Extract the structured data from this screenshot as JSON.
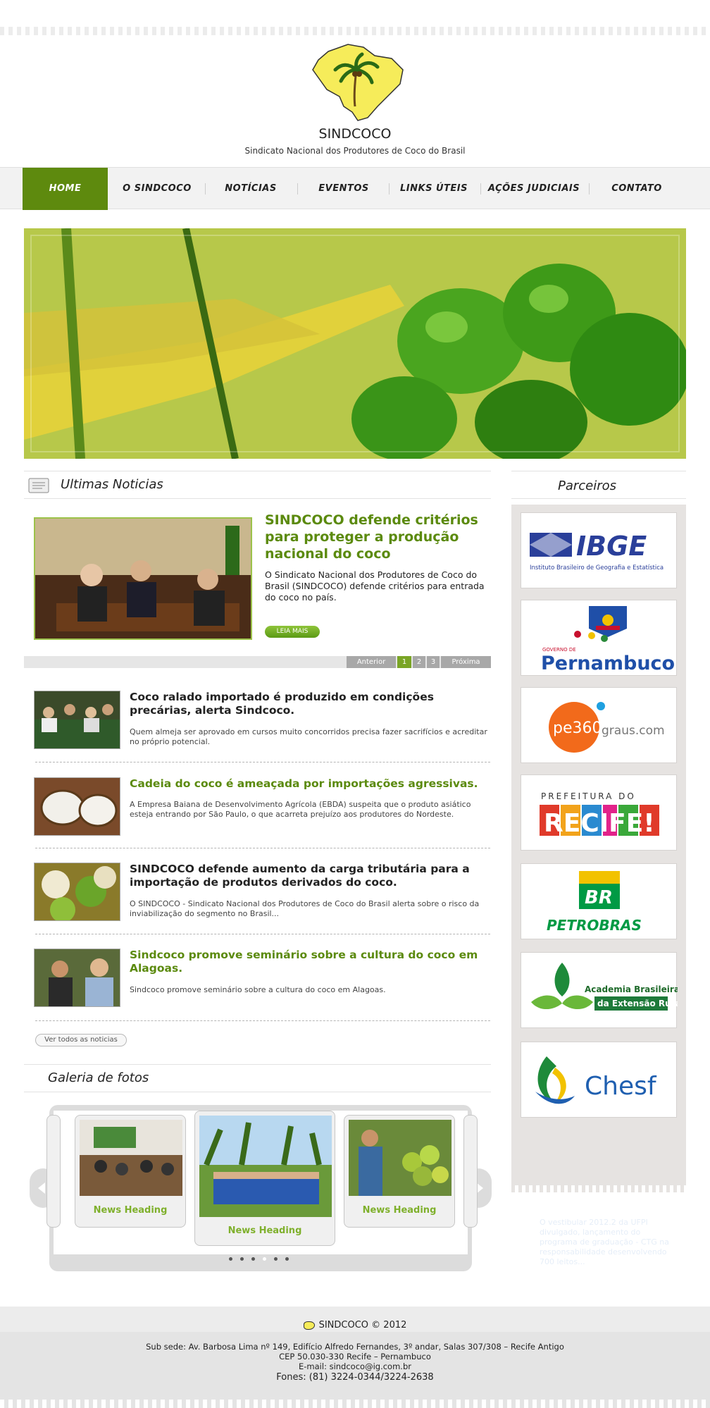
{
  "header": {
    "brand": "SINDCOCO",
    "tagline": "Sindicato Nacional dos Produtores de Coco do Brasil"
  },
  "nav": {
    "items": [
      "HOME",
      "O SINDCOCO",
      "NOTÍCIAS",
      "EVENTOS",
      "LINKS ÚTEIS",
      "AÇÕES JUDICIAIS",
      "CONTATO"
    ],
    "active": "HOME"
  },
  "colors": {
    "accent": "#5e8a0e",
    "link_green": "#5b8a0e",
    "caption_green": "#7fb02c"
  },
  "news_section": {
    "title": "Ultimas Noticias",
    "featured": {
      "title": "SINDCOCO defende critérios para proteger a produção nacional do coco",
      "text": "O Sindicato Nacional dos Produtores de Coco do Brasil (SINDCOCO) defende critérios para entrada do coco no país.",
      "button": "LEIA MAIS"
    },
    "pager": {
      "prev": "Anterior",
      "pages": [
        "1",
        "2",
        "3"
      ],
      "current": "1",
      "next": "Próxima"
    },
    "items": [
      {
        "title": "Coco ralado importado é produzido em condições precárias, alerta Sindcoco.",
        "text": "Quem almeja ser aprovado em cursos muito concorridos precisa fazer sacrifícios e acreditar no próprio potencial."
      },
      {
        "title": "Cadeia do coco é ameaçada por importações agressivas.",
        "text": "A Empresa Baiana de Desenvolvimento Agrícola (EBDA) suspeita que o produto asiático esteja entrando por São Paulo, o que acarreta prejuízo aos produtores do Nordeste."
      },
      {
        "title": "SINDCOCO defende aumento da carga tributária para a importação de produtos derivados do coco.",
        "text": "O SINDCOCO - Sindicato Nacional dos Produtores de Coco do Brasil alerta sobre o risco da inviabilização do segmento no Brasil..."
      },
      {
        "title": "Sindcoco promove seminário sobre a cultura do coco em Alagoas.",
        "text": "Sindcoco promove seminário sobre a cultura do coco em Alagoas."
      }
    ],
    "see_all": "Ver todos as noticias"
  },
  "gallery": {
    "title": "Galeria de fotos",
    "cards": [
      {
        "caption": "News Heading"
      },
      {
        "caption": "News Heading"
      },
      {
        "caption": "News Heading"
      }
    ]
  },
  "sidebar": {
    "title": "Parceiros",
    "partners": [
      {
        "name": "IBGE",
        "subtitle": "Instituto Brasileiro de Geografia e Estatística"
      },
      {
        "name": "Pernambuco",
        "subtitle": "GOVERNO DE"
      },
      {
        "name": "pe360",
        "subtitle": "graus.com"
      },
      {
        "name": "RECIFE!",
        "subtitle": "PREFEITURA DO"
      },
      {
        "name": "BR",
        "subtitle": "PETROBRAS"
      },
      {
        "name": "Academia Brasileira",
        "subtitle": "da Extensão Rural"
      },
      {
        "name": "Chesf",
        "subtitle": ""
      }
    ],
    "ghost_text": "O vestibular 2012.2 da UFPI divulgado, lançamento do programa de graduação - CTG na responsabilidade desenvolvendo 700 leitos..."
  },
  "footer": {
    "copyright": "SINDCOCO © 2012",
    "address": "Sub sede: Av. Barbosa Lima nº 149, Edifício Alfredo Fernandes, 3º andar, Salas  307/308 – Recife Antigo",
    "cep": "CEP 50.030-330 Recife – Pernambuco",
    "email": "E-mail: sindcoco@ig.com.br",
    "phones": "Fones: (81) 3224-0344/3224-2638"
  }
}
